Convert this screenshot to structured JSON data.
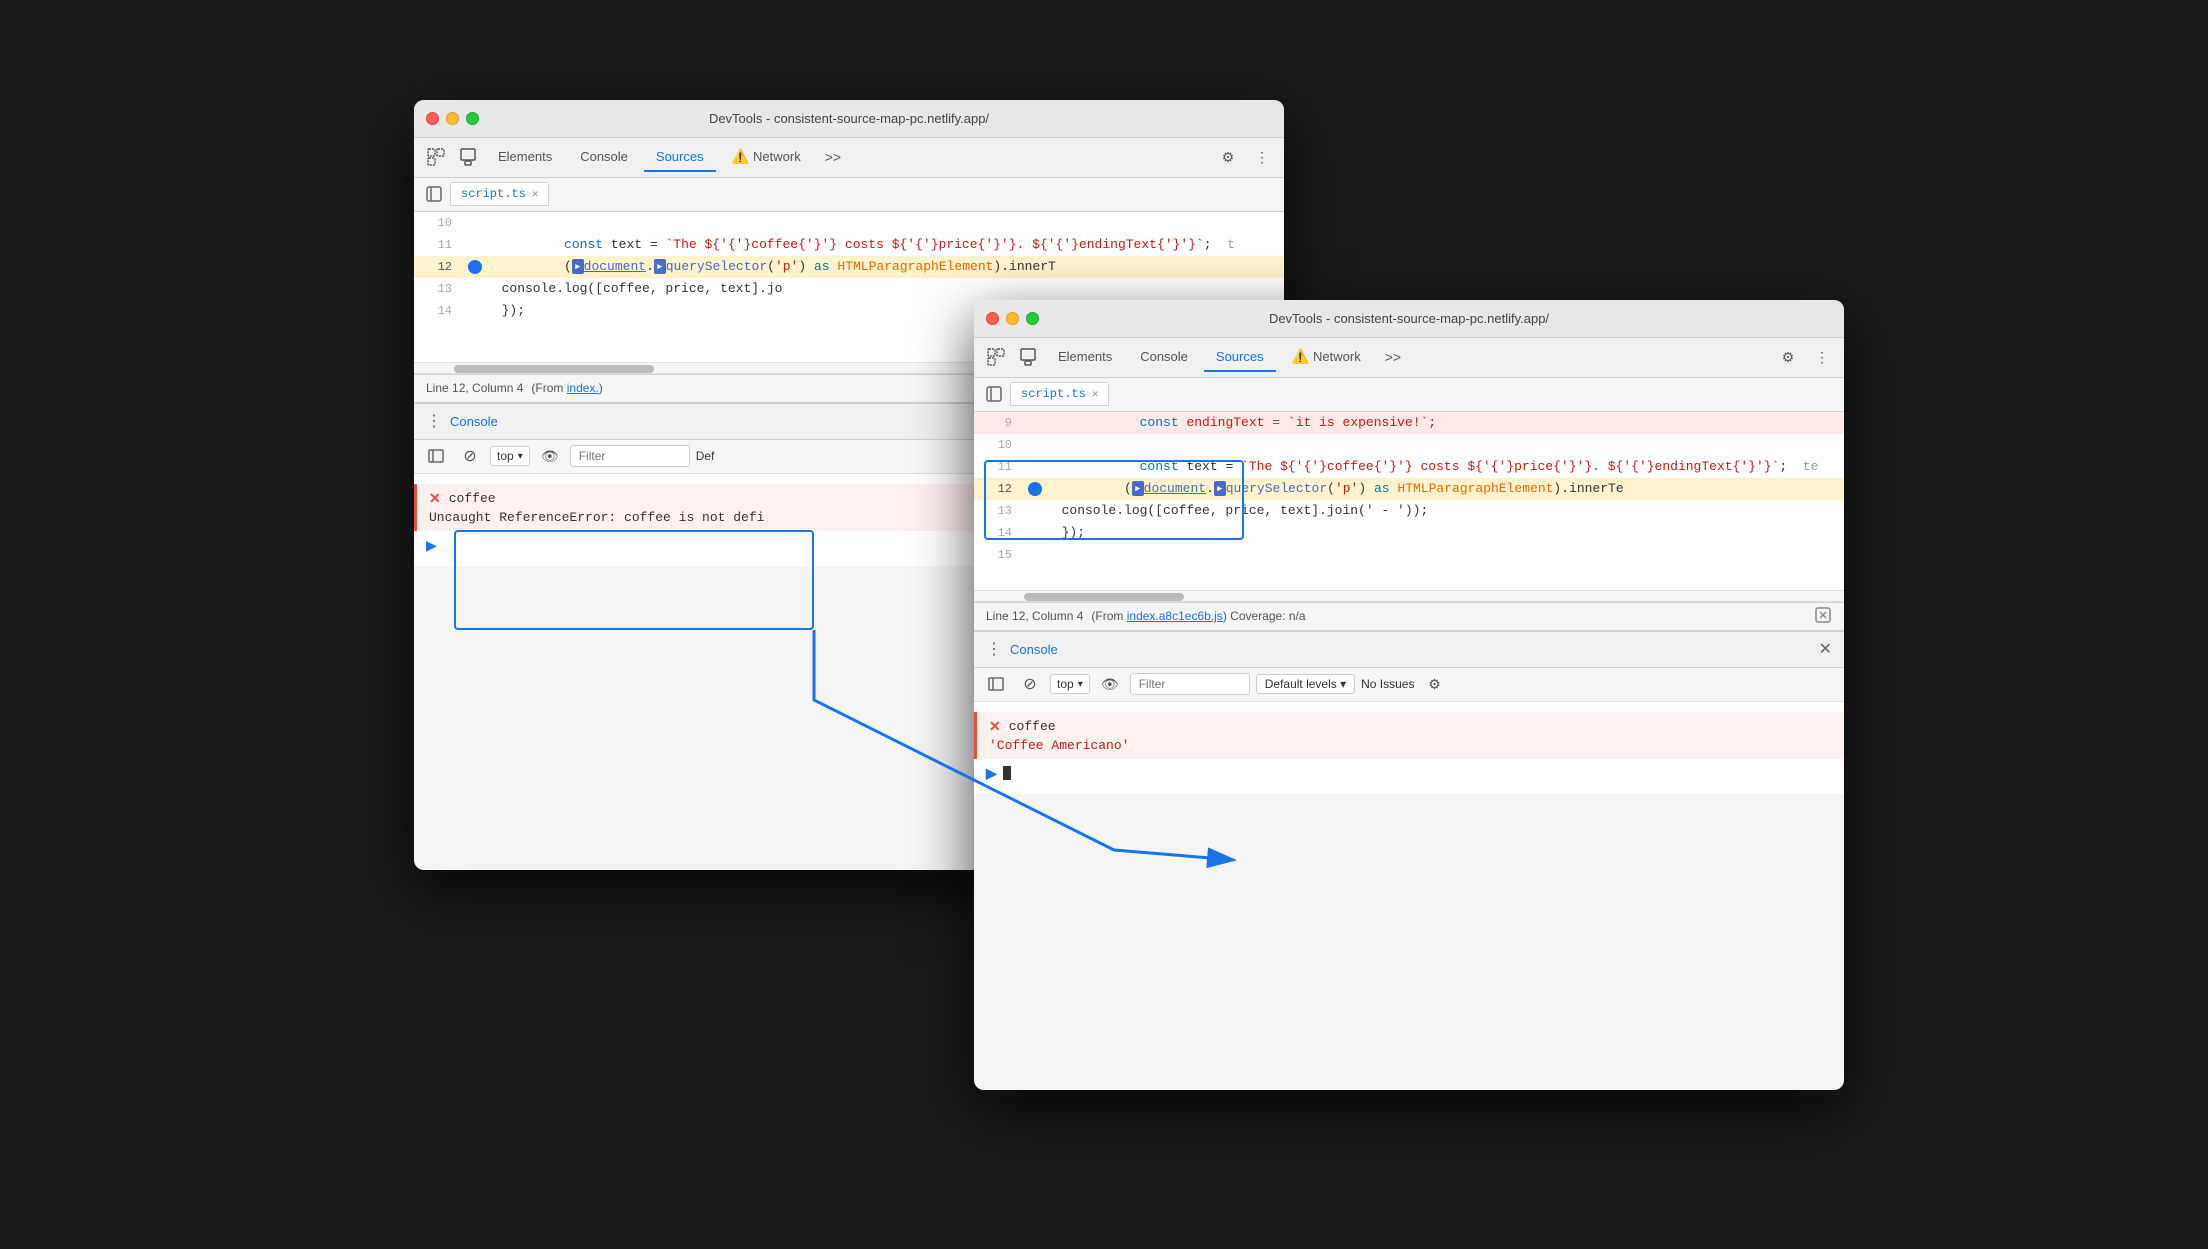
{
  "back_window": {
    "title": "DevTools - consistent-source-map-pc.netlify.app/",
    "tabs": [
      "Elements",
      "Console",
      "Sources",
      "Network",
      ">>"
    ],
    "active_tab": "Sources",
    "file_tab": "script.ts",
    "code_lines": [
      {
        "num": 10,
        "content": "",
        "highlighted": false
      },
      {
        "num": 11,
        "content": "  const text = `The ${coffee} costs ${price}. ${endingText}`;  t",
        "highlighted": false
      },
      {
        "num": 12,
        "content": "  (",
        "highlighted": true,
        "has_breakpoint": true
      },
      {
        "num": 13,
        "content": "  console.log([coffee, price, text].jo",
        "highlighted": false
      },
      {
        "num": 14,
        "content": "  });",
        "highlighted": false
      }
    ],
    "line12_detail": "document.querySelector('p') as HTMLParagraphElement).innerT",
    "status_bar": {
      "text": "Line 12, Column 4",
      "from_text": "(From index.",
      "link": "index..."
    },
    "console_title": "Console",
    "console_top": "top",
    "console_filter_placeholder": "Filter",
    "console_default_levels": "Default levels",
    "error_name": "coffee",
    "error_msg": "Uncaught ReferenceError: coffee is not defi",
    "prompt": ">"
  },
  "front_window": {
    "title": "DevTools - consistent-source-map-pc.netlify.app/",
    "tabs": [
      "Elements",
      "Console",
      "Sources",
      "Network",
      ">>"
    ],
    "active_tab": "Sources",
    "file_tab": "script.ts",
    "code_lines": [
      {
        "num": 9,
        "content": "  const endingText = `it is expensive!`;",
        "highlighted": false
      },
      {
        "num": 10,
        "content": "",
        "highlighted": false
      },
      {
        "num": 11,
        "content": "  const text = `The ${coffee} costs ${price}. ${endingText}`;  te",
        "highlighted": false
      },
      {
        "num": 12,
        "content": "  (",
        "highlighted": true,
        "has_breakpoint": true
      },
      {
        "num": 13,
        "content": "  console.log([coffee, price, text].join(' - '));",
        "highlighted": false
      },
      {
        "num": 14,
        "content": "  });",
        "highlighted": false
      },
      {
        "num": 15,
        "content": "",
        "highlighted": false
      }
    ],
    "line12_detail": "document.querySelector('p') as HTMLParagraphElement).innerTe",
    "status_bar": {
      "text": "Line 12, Column 4",
      "from_text": "(From ",
      "link": "index.a8c1ec6b.js",
      "coverage": "Coverage: n/a"
    },
    "console_title": "Console",
    "console_top": "top",
    "console_filter_placeholder": "Filter",
    "console_default_levels": "Default levels ▾",
    "console_no_issues": "No Issues",
    "error_name": "coffee",
    "value_str": "'Coffee Americano'",
    "prompt": ">",
    "prompt_cursor": "|"
  },
  "arrow": {
    "description": "Blue arrow from back window error box to front window value box"
  }
}
